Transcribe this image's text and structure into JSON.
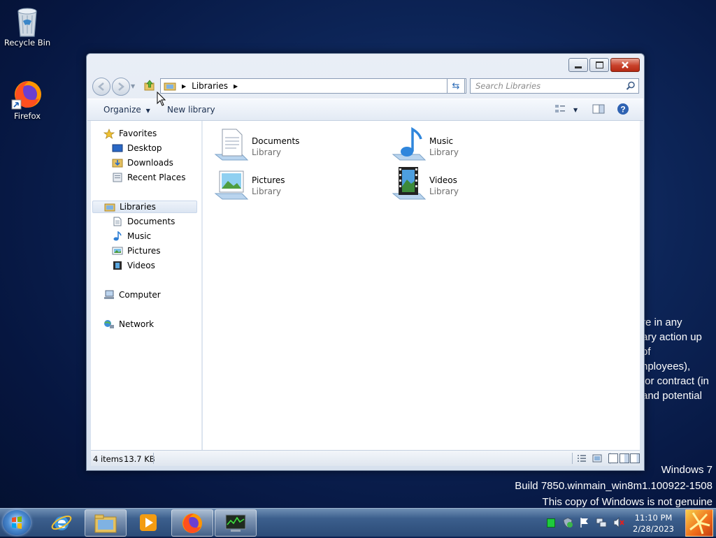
{
  "desktop": {
    "icons": [
      {
        "label": "Recycle Bin",
        "icon": "recycle-bin-icon"
      },
      {
        "label": "Firefox",
        "icon": "firefox-icon"
      }
    ],
    "background_text": [
      "re in any",
      "ary action up",
      "of",
      "nployees),",
      " or contract (in",
      "and potential"
    ],
    "watermark": {
      "line1": "Windows 7",
      "line2": "Build 7850.winmain_win8m1.100922-1508",
      "line3": "This copy of Windows is not genuine"
    }
  },
  "window": {
    "breadcrumb": "Libraries",
    "search_placeholder": "Search Libraries",
    "toolbar": {
      "organize": "Organize",
      "new_library": "New library"
    },
    "nav": {
      "favorites": "Favorites",
      "favorites_items": [
        "Desktop",
        "Downloads",
        "Recent Places"
      ],
      "libraries": "Libraries",
      "libraries_items": [
        "Documents",
        "Music",
        "Pictures",
        "Videos"
      ],
      "computer": "Computer",
      "network": "Network"
    },
    "libraries": [
      {
        "name": "Documents",
        "type": "Library",
        "icon": "documents-library-icon"
      },
      {
        "name": "Music",
        "type": "Library",
        "icon": "music-library-icon"
      },
      {
        "name": "Pictures",
        "type": "Library",
        "icon": "pictures-library-icon"
      },
      {
        "name": "Videos",
        "type": "Library",
        "icon": "videos-library-icon"
      }
    ],
    "status": {
      "count": "4 items",
      "size": "13.7 KB"
    }
  },
  "taskbar": {
    "apps": [
      "internet-explorer",
      "windows-explorer",
      "windows-media-player",
      "firefox",
      "task-manager"
    ],
    "clock": {
      "time": "11:10 PM",
      "date": "2/28/2023"
    }
  },
  "colors": {
    "accent": "#2a6ab6",
    "close": "#c8402a",
    "taskbar": "#3c5f8d"
  }
}
